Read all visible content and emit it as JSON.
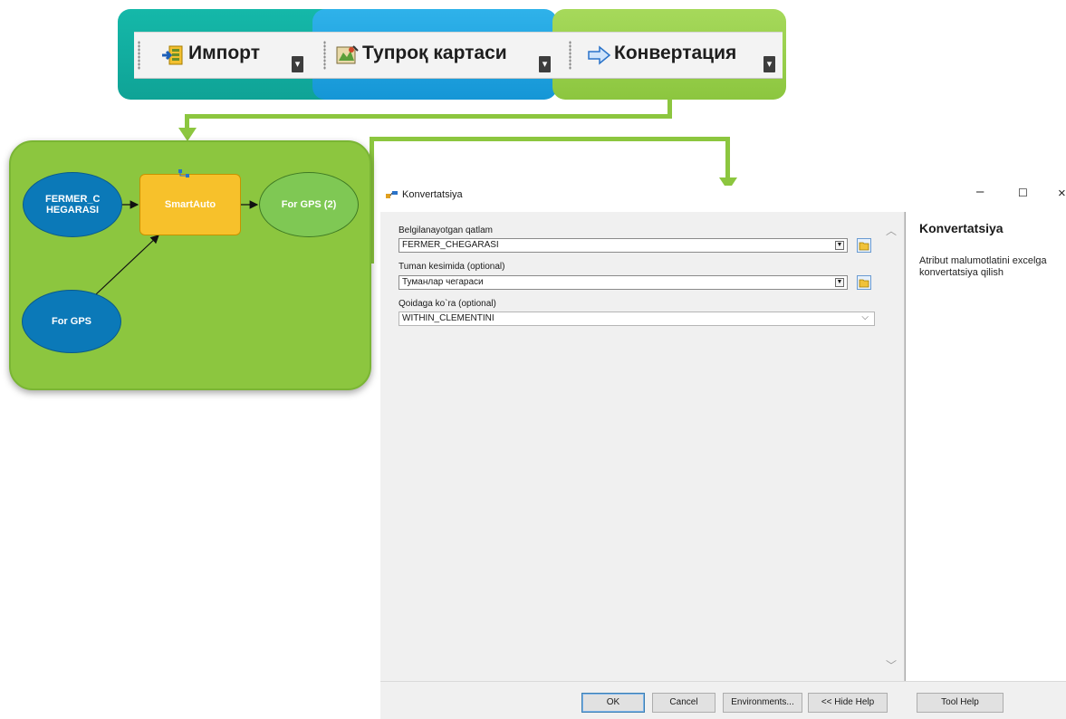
{
  "toolbars": [
    {
      "label": "Импорт",
      "icon": "import-icon"
    },
    {
      "label": "Тупроқ картаси",
      "icon": "soil-map-icon"
    },
    {
      "label": "Конвертация",
      "icon": "convert-arrow-icon"
    }
  ],
  "model": {
    "input1": "FERMER_C HEGARASI",
    "input2": "For GPS",
    "process": "SmartAuto",
    "output": "For GPS (2)"
  },
  "dialog": {
    "title": "Konvertatsiya",
    "fields": [
      {
        "label": "Belgilanayotgan qatlam",
        "value": "FERMER_CHEGARASI"
      },
      {
        "label": "Tuman kesimida (optional)",
        "value": "Туманлар чегараси"
      },
      {
        "label": "Qoidaga ko`ra (optional)",
        "value": "WITHIN_CLEMENTINI"
      }
    ],
    "help_title": "Konvertatsiya",
    "help_text": "Atribut malumotlatini excelga konvertatsiya qilish",
    "buttons": {
      "ok": "OK",
      "cancel": "Cancel",
      "environments": "Environments...",
      "hide_help": "<< Hide Help",
      "tool_help": "Tool Help"
    }
  },
  "colors": {
    "teal": "#15b8a9",
    "blue": "#2fb2ea",
    "green": "#8cc63f",
    "process_yellow": "#f7c12b",
    "data_blue": "#0b79b8"
  }
}
